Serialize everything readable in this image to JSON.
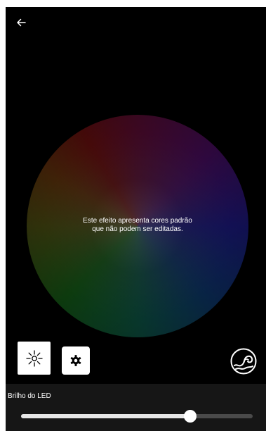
{
  "icons": {
    "back": "arrow-left",
    "effect": "sparkle",
    "settings": "gear",
    "wave": "wave-circle"
  },
  "color_wheel": {
    "message": "Este efeito apresenta cores padrão\nque não podem ser editadas."
  },
  "brightness": {
    "label": "Brilho do LED",
    "value_fraction": 0.73
  },
  "colors": {
    "background": "#000000",
    "panel": "#161616",
    "track": "#4a4a4a",
    "fill": "#e6e6e6",
    "button": "#ffffff"
  }
}
